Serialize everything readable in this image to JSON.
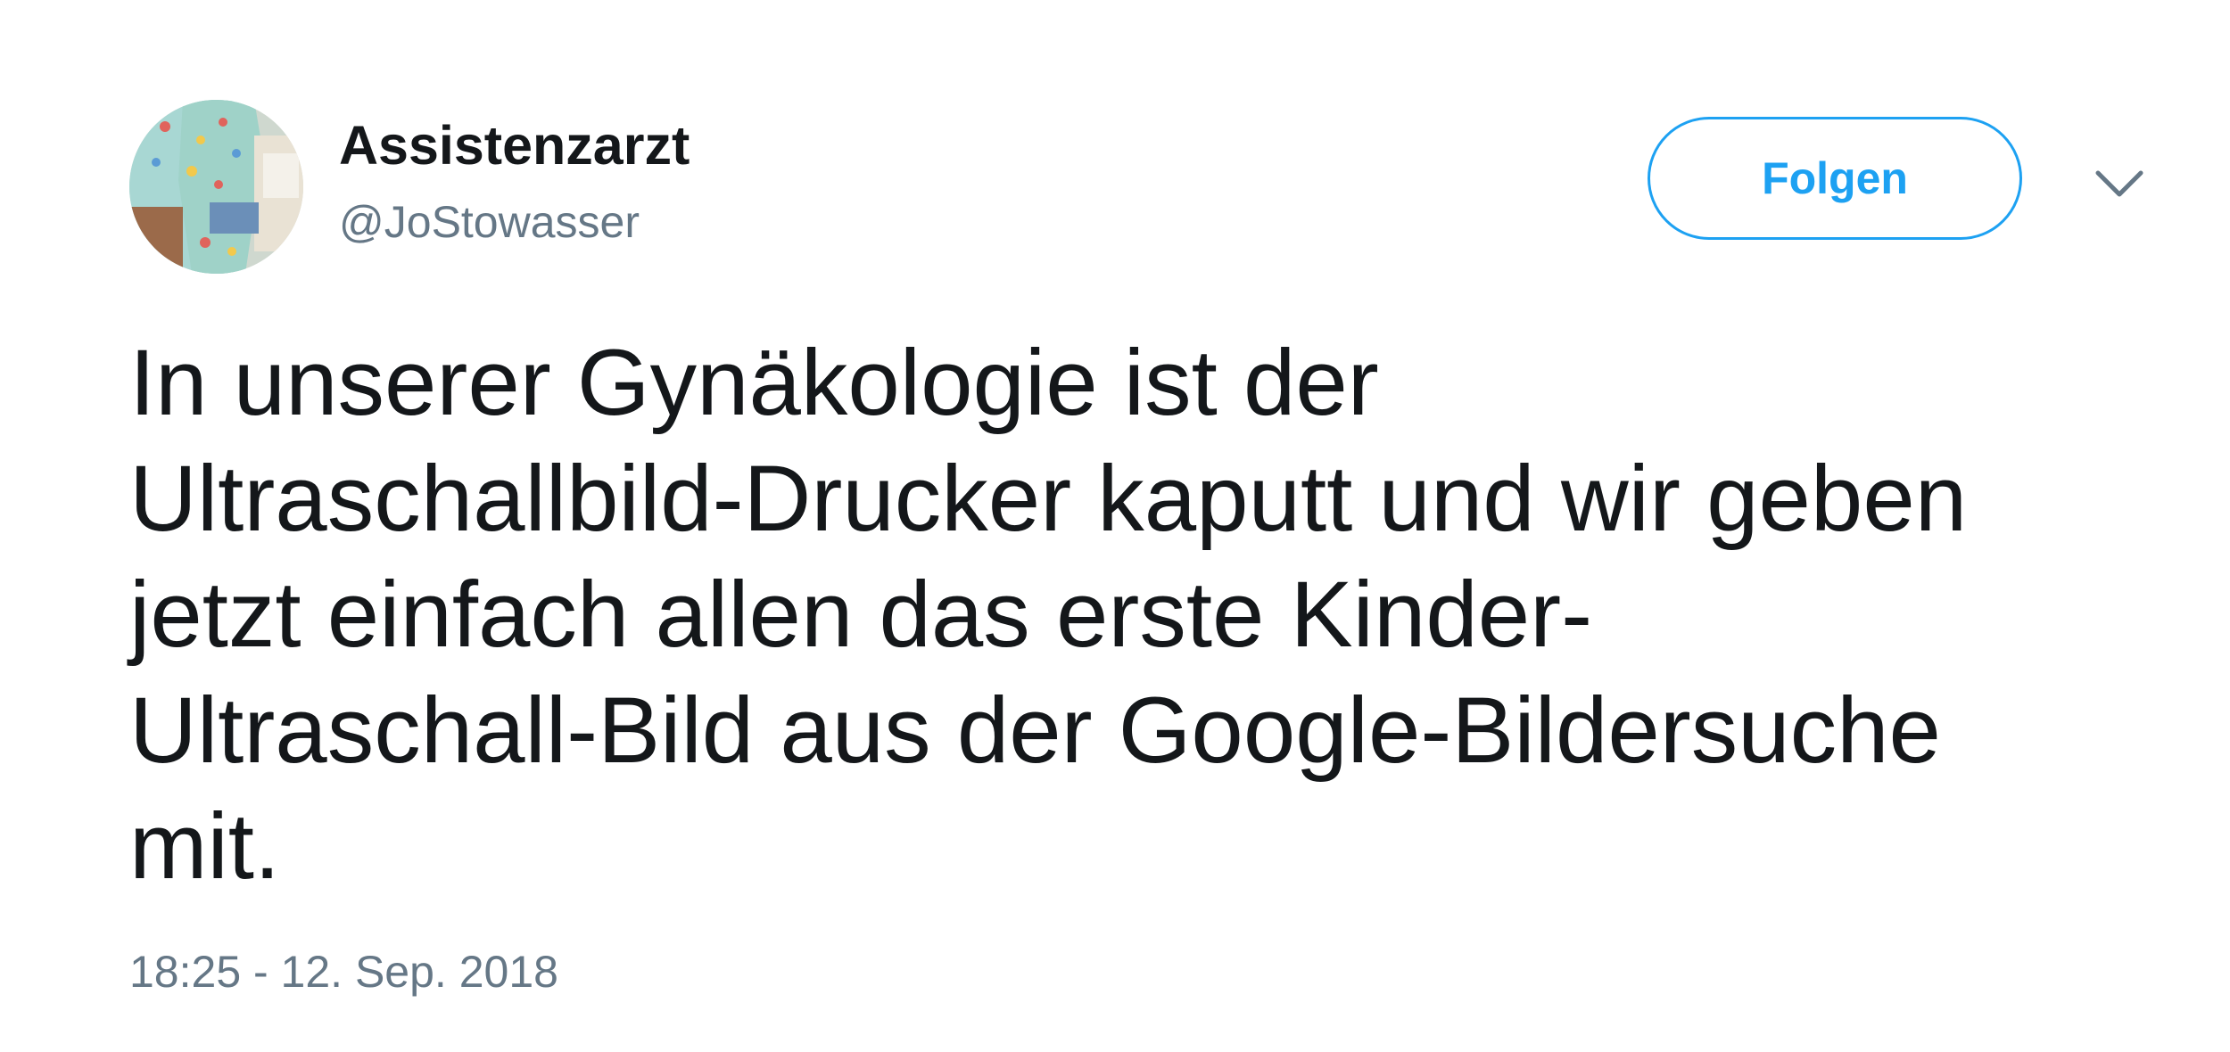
{
  "tweet": {
    "author": {
      "display_name": "Assistenzarzt",
      "handle": "@JoStowasser"
    },
    "follow_label": "Folgen",
    "text": "In unserer Gynäkologie ist der\nUltraschallbild-Drucker kaputt und wir geben\njetzt einfach allen das erste Kinder-\nUltraschall-Bild aus der Google-Bildersuche\nmit.",
    "timestamp": "18:25 - 12. Sep. 2018"
  },
  "colors": {
    "text": "#14171a",
    "secondary_text": "#657786",
    "accent": "#1da1f2",
    "background": "#ffffff"
  },
  "icons": {
    "avatar": "profile-photo",
    "more": "chevron-down-icon"
  }
}
